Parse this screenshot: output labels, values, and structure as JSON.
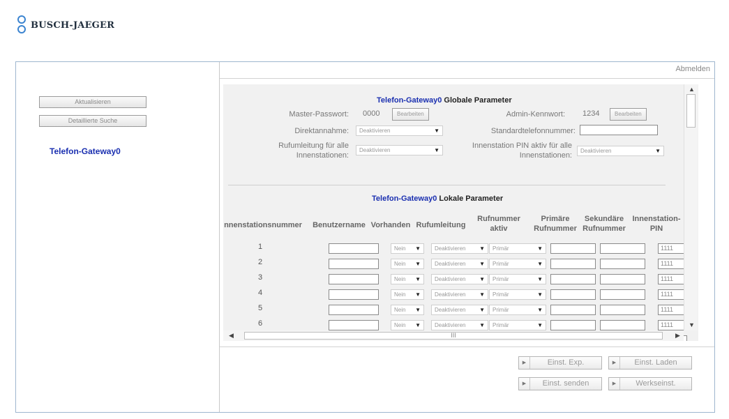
{
  "header": {
    "brand": "BUSCH-JAEGER"
  },
  "sidebar": {
    "refresh_button": "Aktualisieren",
    "advanced_search_button": "Detaillierte Suche",
    "gateway_link": "Telefon-Gateway0"
  },
  "logout": "Abmelden",
  "global_params": {
    "gateway_name": "Telefon-Gateway0",
    "title_suffix": "Globale Parameter",
    "master_password_label": "Master-Passwort:",
    "master_password_value": "0000",
    "admin_password_label": "Admin-Kennwort:",
    "admin_password_value": "1234",
    "edit_label": "Bearbeiten",
    "direct_answer_label": "Direktannahme:",
    "direct_answer_value": "Deaktivieren",
    "default_phone_label": "Standardtelefonnummer:",
    "default_phone_value": "",
    "call_forward_label_1": "Rufumleitung für alle",
    "call_forward_label_2": "Innenstationen:",
    "call_forward_value": "Deaktivieren",
    "pin_active_label_1": "Innenstation PIN aktiv für alle",
    "pin_active_label_2": "Innenstationen:",
    "pin_active_value": "Deaktivieren"
  },
  "local_params": {
    "gateway_name": "Telefon-Gateway0",
    "title_suffix": "Lokale Parameter",
    "columns": {
      "station": "nnenstationsnummer",
      "username": "Benutzername",
      "present": "Vorhanden",
      "forward": "Rufumleitung",
      "active_1": "Rufnummer",
      "active_2": "aktiv",
      "primary_1": "Primäre",
      "primary_2": "Rufnummer",
      "secondary_1": "Sekundäre",
      "secondary_2": "Rufnummer",
      "pin_1": "Innenstation-",
      "pin_2": "PIN"
    },
    "rows": [
      {
        "num": "1",
        "present": "Nein",
        "forward": "Deaktivieren",
        "active": "Primär",
        "pin": "1111"
      },
      {
        "num": "2",
        "present": "Nein",
        "forward": "Deaktivieren",
        "active": "Primär",
        "pin": "1111"
      },
      {
        "num": "3",
        "present": "Nein",
        "forward": "Deaktivieren",
        "active": "Primär",
        "pin": "1111"
      },
      {
        "num": "4",
        "present": "Nein",
        "forward": "Deaktivieren",
        "active": "Primär",
        "pin": "1111"
      },
      {
        "num": "5",
        "present": "Nein",
        "forward": "Deaktivieren",
        "active": "Primär",
        "pin": "1111"
      },
      {
        "num": "6",
        "present": "Nein",
        "forward": "Deaktivieren",
        "active": "Primär",
        "pin": "1111"
      }
    ]
  },
  "hscroll_grip": "III",
  "actions": {
    "export": "Einst. Exp.",
    "load": "Einst. Laden",
    "send": "Einst. senden",
    "factory": "Werkseinst."
  },
  "colors": {
    "accent": "#1a2fb0",
    "logo": "#3b84d0",
    "frame": "#9eb6cf"
  }
}
